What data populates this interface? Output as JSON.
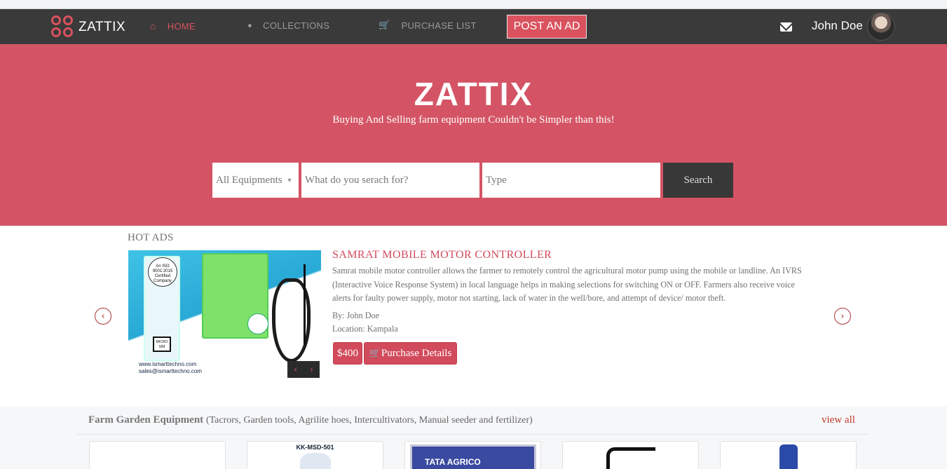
{
  "navbar": {
    "brand": "ZATTIX",
    "items": [
      {
        "label": "HOME",
        "icon": "home-icon"
      },
      {
        "label": "COLLECTIONS",
        "icon": "square-icon"
      },
      {
        "label": "PURCHASE LIST",
        "icon": "cart-icon"
      }
    ],
    "post_ad": "POST AN AD",
    "user_name": "John Doe"
  },
  "hero": {
    "title": "ZATTIX",
    "subtitle": "Buying And Selling farm equipment Couldn't be Simpler than this!",
    "search": {
      "category": "All Equipments",
      "query_placeholder": "What do you serach for?",
      "type_placeholder": "Type",
      "button": "Search"
    }
  },
  "hot_ads": {
    "label": "HOT ADS",
    "ad": {
      "title": "SAMRAT MOBILE MOTOR CONTROLLER",
      "description": "Samrat mobile motor controller allows the farmer to remotely control the agricultural motor pump using the mobile or landline. An IVRS (Interactive Voice Response System) in local language helps in making selections for switching ON or OFF. Farmers also receive voice alerts for faulty power supply, motor not starting, lack of water in the well/bore, and attempt of device/ motor theft.",
      "by": "By: John Doe",
      "location": "Location: Kampala",
      "price": "$400",
      "purchase_label": "Purchase Details",
      "image_text": {
        "iso": "An ISO 9001:2015 Certified Company",
        "micro": "MICRO SIM",
        "url1": "www.ismarttechno.com",
        "url2": "sales@ismarttechno.com"
      }
    }
  },
  "category": {
    "title": "Farm Garden Equipment",
    "subtitle": "(Tacrors, Garden tools, Agrilite hoes, Intercultivators, Manual seeder and fertilizer)",
    "view_all": "view all",
    "products": [
      {
        "label": ""
      },
      {
        "label": "KK-MSD-501"
      },
      {
        "label": "TATA AGRICO"
      },
      {
        "label": ""
      },
      {
        "label": ""
      }
    ]
  },
  "colors": {
    "navbar": "#3a3a3a",
    "hero": "#d45465",
    "accent": "#d24b5c"
  }
}
